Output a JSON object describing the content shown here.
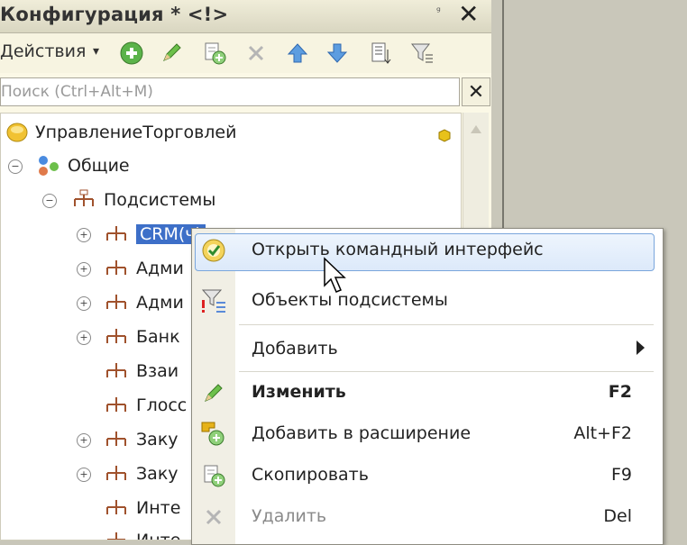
{
  "window": {
    "title": "Конфигурация * <!>",
    "pin": "ᵍ",
    "close": "✕"
  },
  "toolbar": {
    "actions_label": "Действия",
    "icons": [
      "add-icon",
      "edit-icon",
      "add-copy-icon",
      "delete-icon",
      "move-up-icon",
      "move-down-icon",
      "sort-icon",
      "filter-icon"
    ]
  },
  "search": {
    "placeholder": "Поиск (Ctrl+Alt+M)",
    "clear": "✕"
  },
  "tree": {
    "root": "УправлениеТорговлей",
    "common": "Общие",
    "subsystems": "Подсистемы",
    "children": [
      "CRM(ч)",
      "Адми",
      "Адми",
      "Банк",
      "Взаи",
      "Глосс",
      "Заку",
      "Заку",
      "Инте",
      "Инте"
    ]
  },
  "context_menu": {
    "items": [
      {
        "label": "Открыть командный интерфейс",
        "shortcut": "",
        "icon": "open-interface-icon"
      },
      {
        "label": "Объекты подсистемы",
        "shortcut": "",
        "icon": "filter-objects-icon"
      },
      {
        "label": "Добавить",
        "shortcut": "",
        "icon": ""
      },
      {
        "label": "Изменить",
        "shortcut": "F2",
        "icon": "edit-icon"
      },
      {
        "label": "Добавить в расширение",
        "shortcut": "Alt+F2",
        "icon": "add-extension-icon"
      },
      {
        "label": "Скопировать",
        "shortcut": "F9",
        "icon": "copy-icon"
      },
      {
        "label": "Удалить",
        "shortcut": "Del",
        "icon": "delete-icon"
      }
    ]
  },
  "colors": {
    "selection": "#3d6fc8",
    "panel_bg": "#fbf8e6",
    "highlight_border": "#7aa6dc"
  }
}
